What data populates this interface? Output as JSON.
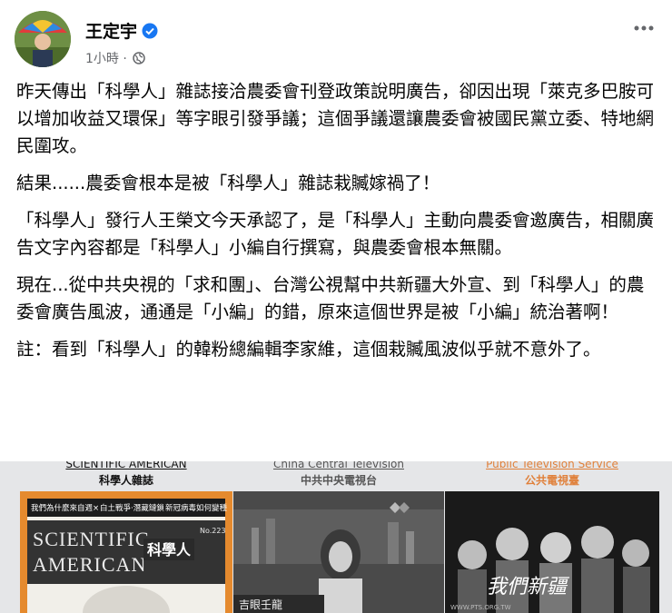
{
  "author": {
    "name": "王定宇",
    "timestamp": "1小時",
    "separator": "·"
  },
  "icons": {
    "verified": "verified-badge-icon",
    "audience": "globe-icon",
    "more": "more-options-icon"
  },
  "paragraphs": [
    "昨天傳出「科學人」雜誌接洽農委會刊登政策說明廣告，卻因出現「萊克多巴胺可以增加收益又環保」等字眼引發爭議；這個爭議還讓農委會被國民黨立委、特地網民圍攻。",
    "結果......農委會根本是被「科學人」雜誌栽贓嫁禍了！",
    "「科學人」發行人王榮文今天承認了，是「科學人」主動向農委會邀廣告，相關廣告文字內容都是「科學人」小編自行撰寫，與農委會根本無關。",
    "現在...從中共央視的「求和團」、台灣公視幫中共新疆大外宣、到「科學人」的農委會廣告風波，通通是「小編」的錯，原來這個世界是被「小編」統治著啊！",
    "註：看到「科學人」的韓粉總編輯李家維，這個栽贓風波似乎就不意外了。"
  ],
  "collage": [
    {
      "label_en": "SCIENTIFIC AMERICAN",
      "label_zh": "科學人雜誌",
      "label_color": "#111111",
      "cover_title_1": "SCIENTIFIC",
      "cover_title_2": "AMERICAN",
      "cover_badge": "科學人",
      "issue": "No.223",
      "headlines": [
        "我們為什麼來自週×",
        "白土戰爭‧潛藏鏈鎖",
        "新冠病毒如何變種"
      ]
    },
    {
      "label_en": "China Central Television",
      "label_zh": "中共中央電視台",
      "label_color": "#555555",
      "caption": "吉眼壬龍"
    },
    {
      "label_en": "Public Television Service",
      "label_zh": "公共電視臺",
      "label_color": "#e0803a",
      "overlay": "我們新疆",
      "url": "WWW.PTS.ORG.TW"
    }
  ],
  "colors": {
    "link_blue": "#1877f2",
    "meta_gray": "#65676b",
    "cover_orange": "#e58a2e"
  }
}
